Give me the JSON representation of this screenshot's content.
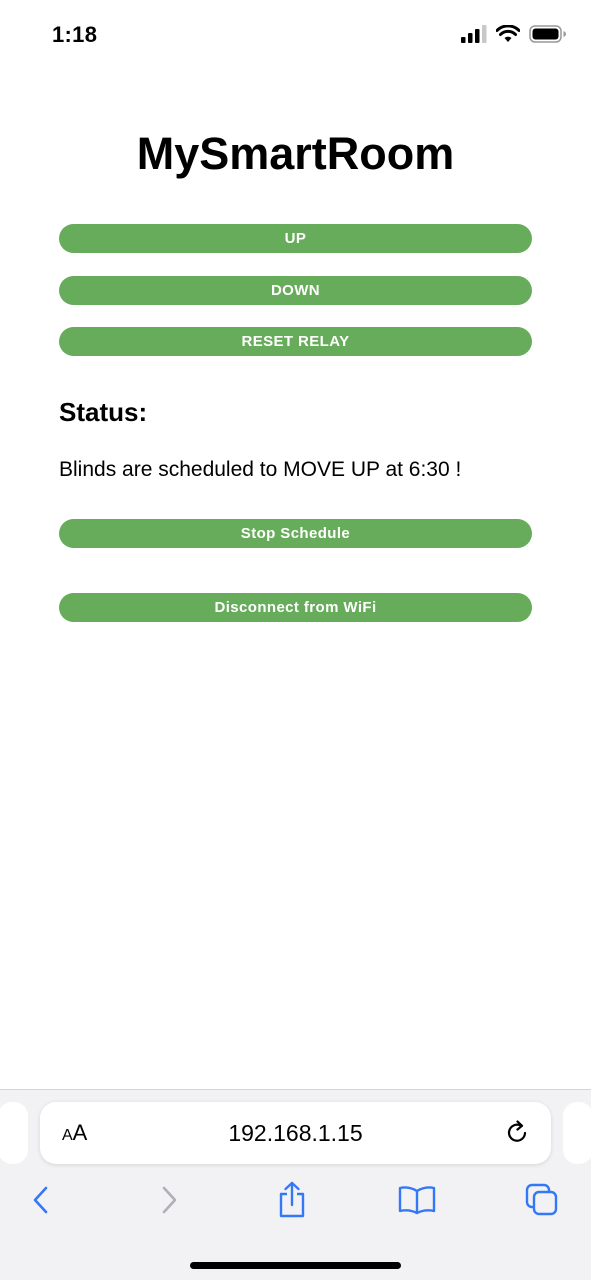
{
  "status_bar": {
    "time": "1:18",
    "signal_icon": "cellular-signal-icon",
    "wifi_icon": "wifi-icon",
    "battery_icon": "battery-icon"
  },
  "page": {
    "title": "MySmartRoom",
    "buttons": {
      "up": "UP",
      "down": "DOWN",
      "reset_relay": "RESET RELAY",
      "stop_schedule": "Stop Schedule",
      "disconnect_wifi": "Disconnect from WiFi"
    },
    "status_heading": "Status:",
    "status_message": "Blinds are scheduled to MOVE UP at 6:30 !"
  },
  "browser": {
    "text_size_button": {
      "small": "A",
      "large": "A"
    },
    "url": "192.168.1.15",
    "icons": {
      "reload": "reload-icon",
      "back": "back-chevron-icon",
      "forward": "forward-chevron-icon",
      "share": "share-icon",
      "bookmarks": "bookmarks-icon",
      "tabs": "tabs-icon"
    }
  },
  "colors": {
    "button_green": "#67ac5b",
    "button_text": "#ffffff",
    "ios_blue": "#3478f6",
    "disabled_gray": "#b0b0b5"
  }
}
